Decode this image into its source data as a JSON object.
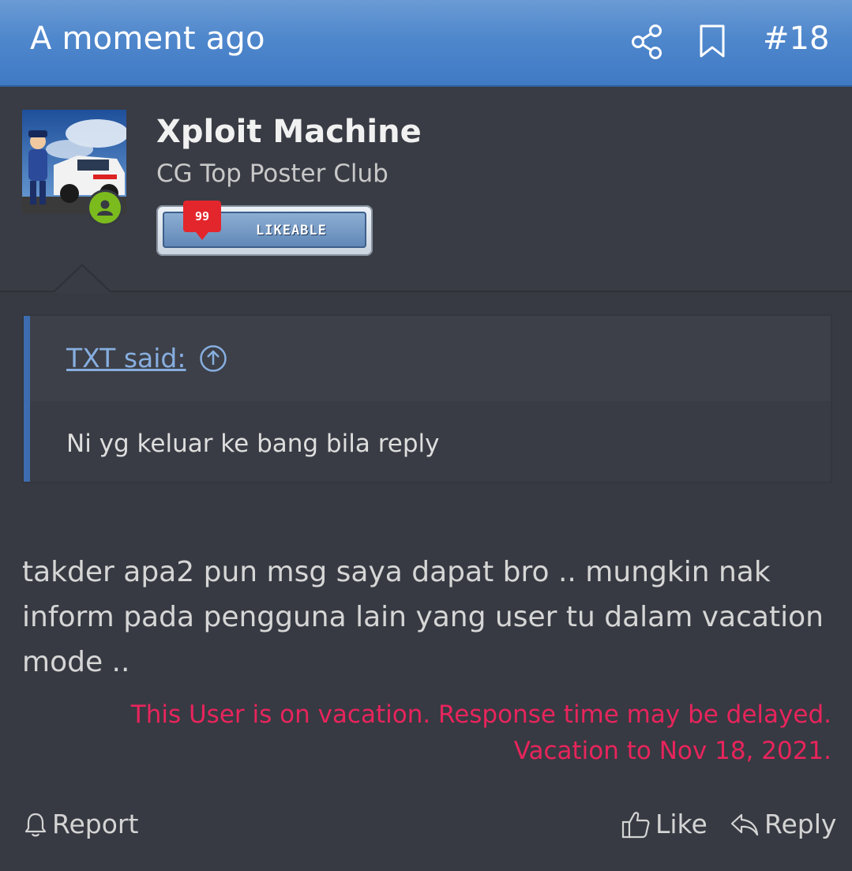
{
  "header": {
    "timestamp": "A moment ago",
    "post_number": "#18",
    "share_icon": "share-icon",
    "bookmark_icon": "bookmark-icon"
  },
  "author": {
    "name": "Xploit Machine",
    "title": "CG Top Poster Club",
    "online_status_icon": "user-online-icon",
    "badge": {
      "count": "99",
      "label": "LIKEABLE"
    }
  },
  "quote": {
    "attribution": "TXT said:",
    "jump_icon": "arrow-up-circle-icon",
    "text": "Ni yg keluar ke bang bila reply"
  },
  "post": {
    "body": "takder apa2 pun msg saya dapat bro .. mungkin nak inform pada pengguna lain yang user tu dalam vacation mode ..",
    "vacation_notice": "This User is on vacation. Response time may be delayed. Vacation to Nov 18, 2021."
  },
  "actions": {
    "report_label": "Report",
    "like_label": "Like",
    "reply_label": "Reply"
  },
  "colors": {
    "header_blue": "#4f87cc",
    "background": "#373a42",
    "link": "#87aee0",
    "vacation_notice": "#e8245c",
    "online_green": "#7cbb1d"
  }
}
